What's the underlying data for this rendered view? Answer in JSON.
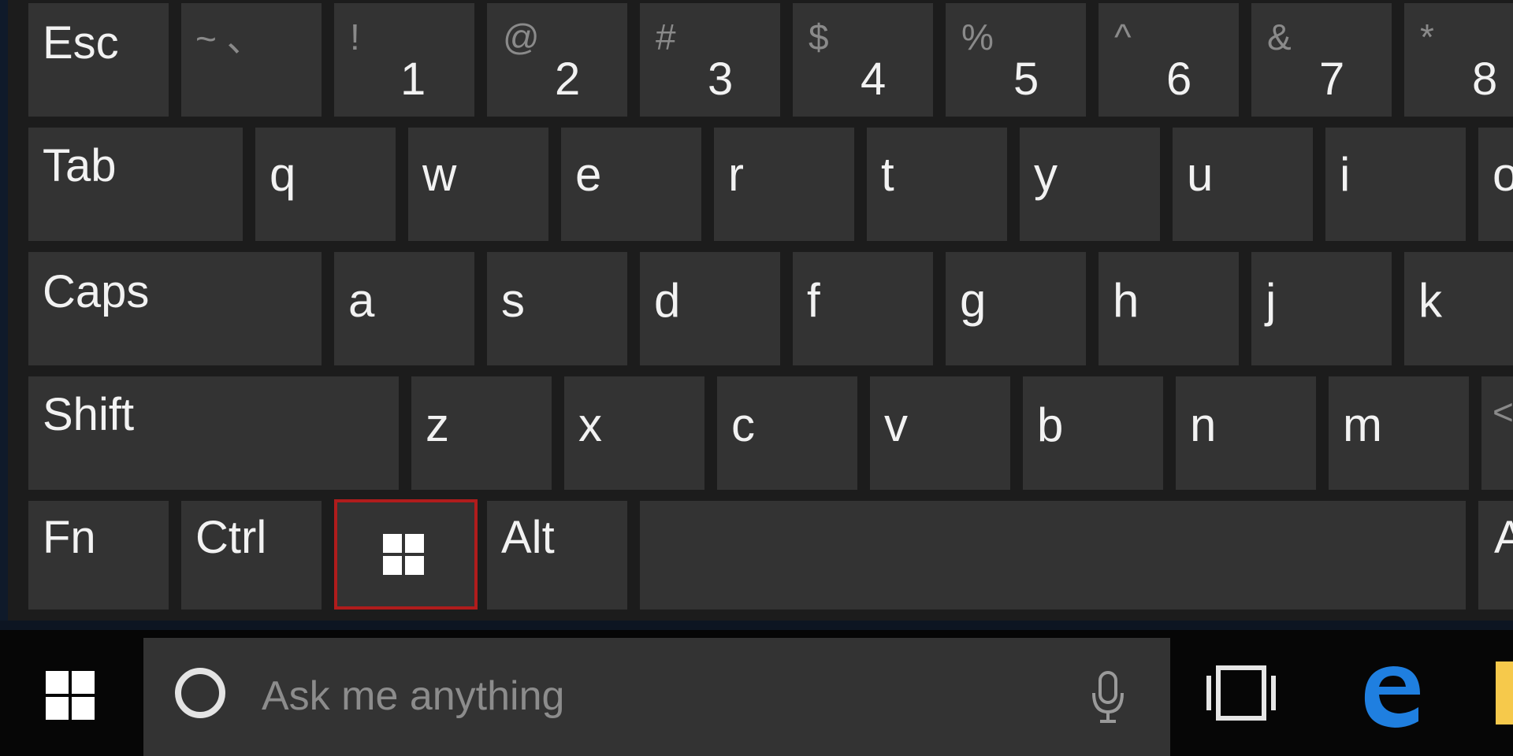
{
  "keyboard": {
    "row1": {
      "esc": "Esc",
      "k1": {
        "shift": "!",
        "main": "1"
      },
      "k2": {
        "shift": "@",
        "main": "2"
      },
      "k3": {
        "shift": "#",
        "main": "3"
      },
      "k4": {
        "shift": "$",
        "main": "4"
      },
      "k5": {
        "shift": "%",
        "main": "5"
      },
      "k6": {
        "shift": "^",
        "main": "6"
      },
      "k7": {
        "shift": "&",
        "main": "7"
      },
      "k8": {
        "shift": "*",
        "main": "8"
      },
      "tilde": "~ 、"
    },
    "row2": {
      "tab": "Tab",
      "letters": [
        "q",
        "w",
        "e",
        "r",
        "t",
        "y",
        "u",
        "i",
        "o"
      ]
    },
    "row3": {
      "caps": "Caps",
      "letters": [
        "a",
        "s",
        "d",
        "f",
        "g",
        "h",
        "j",
        "k"
      ]
    },
    "row4": {
      "shift": "Shift",
      "letters": [
        "z",
        "x",
        "c",
        "v",
        "b",
        "n",
        "m",
        "<"
      ]
    },
    "row5": {
      "fn": "Fn",
      "ctrl": "Ctrl",
      "alt": "Alt",
      "alt_right": "A"
    }
  },
  "taskbar": {
    "search_placeholder": "Ask me anything"
  },
  "colors": {
    "key_bg": "#333333",
    "keyboard_bg": "#1c1c1c",
    "highlight": "#b01c1c",
    "edge_blue": "#1f7fe0"
  },
  "icons": {
    "start": "windows-logo-icon",
    "cortana": "cortana-ring-icon",
    "mic": "microphone-icon",
    "task_view": "task-view-icon",
    "edge": "edge-browser-icon",
    "explorer": "file-explorer-icon"
  }
}
